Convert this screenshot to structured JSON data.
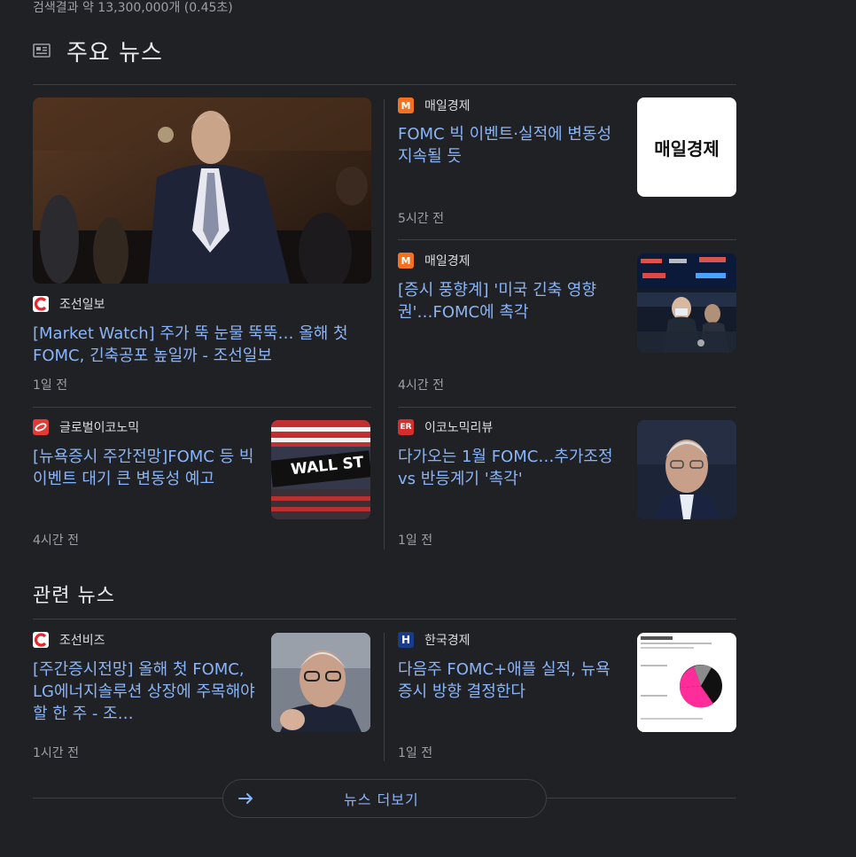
{
  "result_stats": "검색결과 약 13,300,000개 (0.45초)",
  "top_news": {
    "title": "주요 뉴스",
    "articles": [
      {
        "source": "조선일보",
        "headline": "[Market Watch] 주가 뚝 눈물 뚝뚝… 올해 첫 FOMC, 긴축공포 높일까 - 조선일보",
        "time": "1일 전"
      },
      {
        "source": "매일경제",
        "headline": "FOMC 빅 이벤트·실적에 변동성 지속될 듯",
        "time": "5시간 전",
        "thumb_text": "매일경제"
      },
      {
        "source": "매일경제",
        "headline": "[증시 풍향계] '미국 긴축 영향권'…FOMC에 촉각",
        "time": "4시간 전"
      },
      {
        "source": "글로벌이코노믹",
        "headline": "[뉴욕증시 주간전망]FOMC 등 빅 이벤트 대기 큰 변동성 예고",
        "time": "4시간 전",
        "thumb_text": "WALL ST"
      },
      {
        "source": "이코노믹리뷰",
        "headline": "다가오는 1월 FOMC…추가조정 vs 반등계기 '촉각'",
        "time": "1일 전"
      }
    ]
  },
  "related_news": {
    "title": "관련 뉴스",
    "articles": [
      {
        "source": "조선비즈",
        "headline": "[주간증시전망] 올해 첫 FOMC, LG에너지솔루션 상장에 주목해야 할 한 주 - 조…",
        "time": "1시간 전"
      },
      {
        "source": "한국경제",
        "headline": "다음주 FOMC+애플 실적, 뉴욕 증시 방향 결정한다",
        "time": "1일 전",
        "logo_letter": "H"
      }
    ]
  },
  "more_button": {
    "label": "뉴스 더보기"
  },
  "colors": {
    "background": "#202124",
    "link": "#8ab4f8",
    "divider": "#3c4043"
  }
}
